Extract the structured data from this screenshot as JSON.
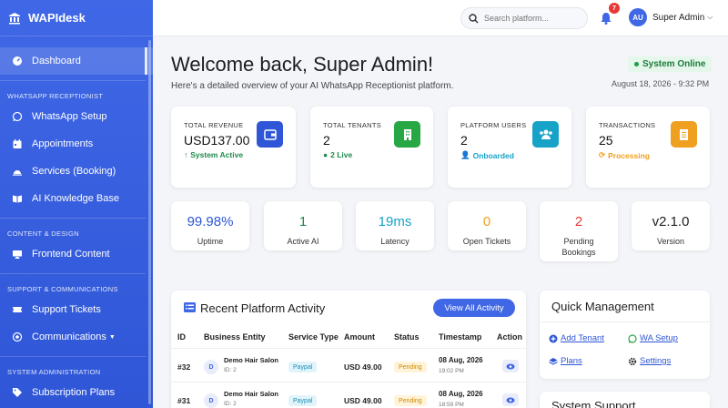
{
  "app": {
    "name": "WAPIdesk"
  },
  "sidebar": {
    "dashboard": "Dashboard",
    "sections": [
      "WHATSAPP RECEPTIONIST",
      "CONTENT & DESIGN",
      "SUPPORT & COMMUNICATIONS",
      "SYSTEM ADMINISTRATION"
    ],
    "items": [
      "WhatsApp Setup",
      "Appointments",
      "Services (Booking)",
      "AI Knowledge Base",
      "Frontend Content",
      "Support Tickets",
      "Communications",
      "Subscription Plans"
    ]
  },
  "topbar": {
    "search_placeholder": "Search platform...",
    "notifications": "7",
    "avatar": "AU",
    "user": "Super Admin"
  },
  "header": {
    "title": "Welcome back, Super Admin!",
    "subtitle": "Here's a detailed overview of your AI WhatsApp Receptionist platform.",
    "status": "System Online",
    "datetime": "August 18, 2026 - 9:32 PM"
  },
  "stats": [
    {
      "label": "TOTAL REVENUE",
      "value": "USD137.00",
      "sub": "System Active",
      "color": "#2f56d6"
    },
    {
      "label": "TOTAL TENANTS",
      "value": "2",
      "sub": "2 Live",
      "color": "#28a745"
    },
    {
      "label": "PLATFORM USERS",
      "value": "2",
      "sub": "Onboarded",
      "color": "#17a2c8"
    },
    {
      "label": "TRANSACTIONS",
      "value": "25",
      "sub": "Processing",
      "color": "#f0a020"
    }
  ],
  "metrics": [
    {
      "value": "99.98%",
      "label": "Uptime",
      "color": "#2f56d6"
    },
    {
      "value": "1",
      "label": "Active AI",
      "color": "#1e8a4c"
    },
    {
      "value": "19ms",
      "label": "Latency",
      "color": "#17a2c8"
    },
    {
      "value": "0",
      "label": "Open Tickets",
      "color": "#f0a020"
    },
    {
      "value": "2",
      "label": "Pending Bookings",
      "color": "#e53935"
    },
    {
      "value": "v2.1.0",
      "label": "Version",
      "color": "#222222"
    }
  ],
  "activity": {
    "title": "Recent Platform Activity",
    "button": "View All Activity",
    "columns": [
      "ID",
      "Business Entity",
      "Service Type",
      "Amount",
      "Status",
      "Timestamp",
      "Action"
    ],
    "rows": [
      {
        "id": "#32",
        "initial": "D",
        "business": "Demo Hair Salon",
        "bid": "ID: 2",
        "service": "Paypal",
        "amount": "USD 49.00",
        "status": "Pending",
        "date": "08 Aug, 2026",
        "time": "19:02 PM"
      },
      {
        "id": "#31",
        "initial": "D",
        "business": "Demo Hair Salon",
        "bid": "ID: 2",
        "service": "Paypal",
        "amount": "USD 49.00",
        "status": "Pending",
        "date": "08 Aug, 2026",
        "time": "18:59 PM"
      }
    ]
  },
  "quick": {
    "title": "Quick Management",
    "links": [
      "Add Tenant",
      "WA Setup",
      "Plans",
      "Settings"
    ]
  },
  "system": {
    "title": "System Support"
  }
}
